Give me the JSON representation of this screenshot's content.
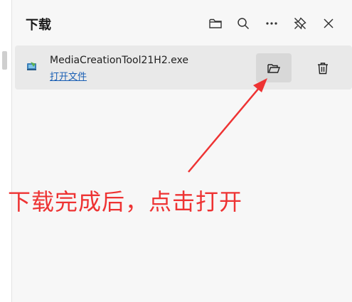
{
  "panel": {
    "title": "下载",
    "header_icons": [
      "folder-icon",
      "search-icon",
      "more-icon",
      "pin-icon",
      "close-icon"
    ]
  },
  "download_item": {
    "file_name": "MediaCreationTool21H2.exe",
    "open_label": "打开文件",
    "icon": "installer-icon",
    "actions": [
      "folder-icon",
      "trash-icon"
    ]
  },
  "annotation": {
    "text": "下载完成后，点击打开",
    "color": "#ee3333"
  }
}
